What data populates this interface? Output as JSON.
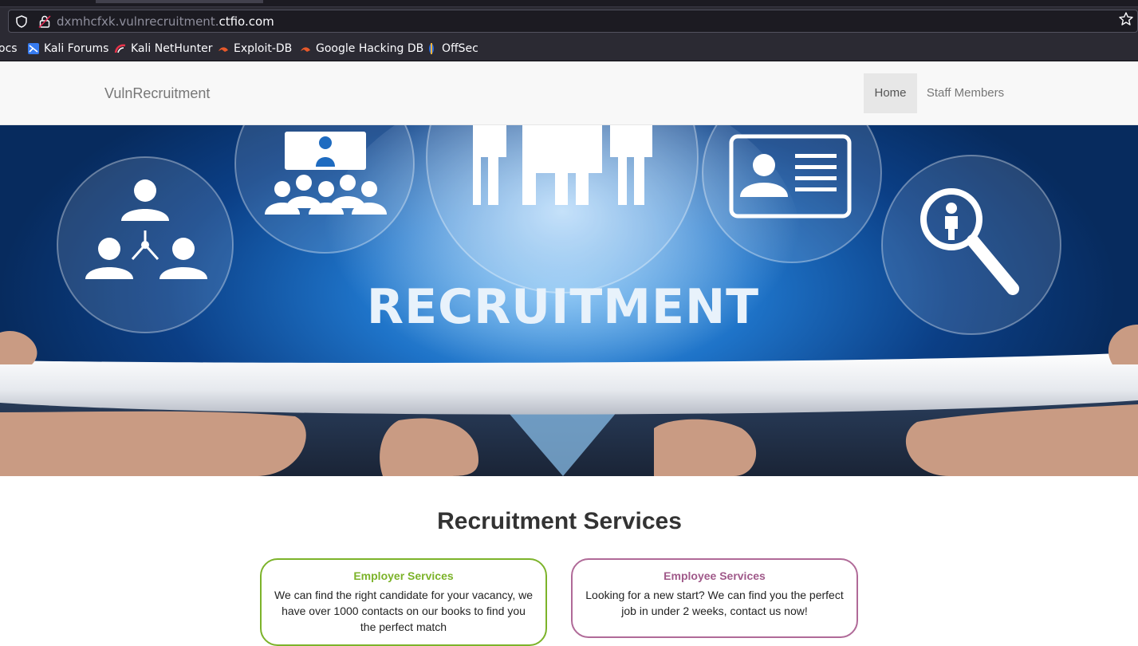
{
  "browser": {
    "url_prefix": "dxmhcfxk.vulnrecruitment.",
    "url_domain": "ctfio.com",
    "icons": [
      "shield-icon",
      "lock-icon",
      "star-icon"
    ],
    "bookmarks": [
      {
        "label": "ocs",
        "icon": ""
      },
      {
        "label": "Kali Forums",
        "icon": "kali-forums-icon"
      },
      {
        "label": "Kali NetHunter",
        "icon": "kali-nethunter-icon"
      },
      {
        "label": "Exploit-DB",
        "icon": "exploit-db-icon"
      },
      {
        "label": "Google Hacking DB",
        "icon": "ghdb-icon"
      },
      {
        "label": "OffSec",
        "icon": "offsec-icon"
      }
    ]
  },
  "navbar": {
    "brand": "VulnRecruitment",
    "items": [
      {
        "label": "Home",
        "active": true
      },
      {
        "label": "Staff Members",
        "active": false
      }
    ]
  },
  "hero": {
    "text": "RECRUITMENT"
  },
  "services": {
    "title": "Recruitment Services",
    "cards": [
      {
        "title": "Employer Services",
        "body": "We can find the right candidate for your vacancy, we have over 1000 contacts on our books to find you the perfect match",
        "color": "#7cb32a"
      },
      {
        "title": "Employee Services",
        "body": "Looking for a new start? We can find you the perfect job in under 2 weeks, contact us now!",
        "color": "#b06a98"
      }
    ]
  }
}
